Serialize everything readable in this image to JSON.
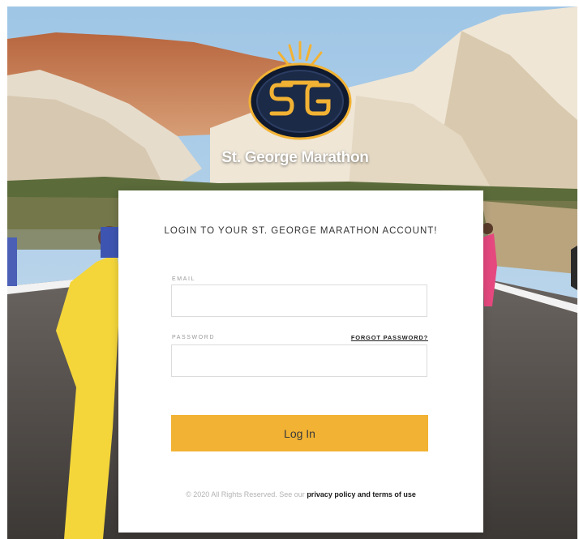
{
  "brand": {
    "name": "St. George Marathon",
    "logo_monogram": "SG",
    "accent_color": "#f2b233",
    "logo_navy": "#16233d"
  },
  "login": {
    "title": "LOGIN TO YOUR ST. GEORGE MARATHON ACCOUNT!",
    "email_label": "EMAIL",
    "email_value": "",
    "password_label": "PASSWORD",
    "password_value": "",
    "forgot_password": "FORGOT PASSWORD?",
    "submit_label": "Log In"
  },
  "footer": {
    "copyright": "© 2020 All Rights Reserved. See our",
    "privacy_link": "privacy policy",
    "and_text": "and",
    "terms_link": "terms of use"
  },
  "icons": {
    "logo": "sun-rays-emblem-icon"
  }
}
